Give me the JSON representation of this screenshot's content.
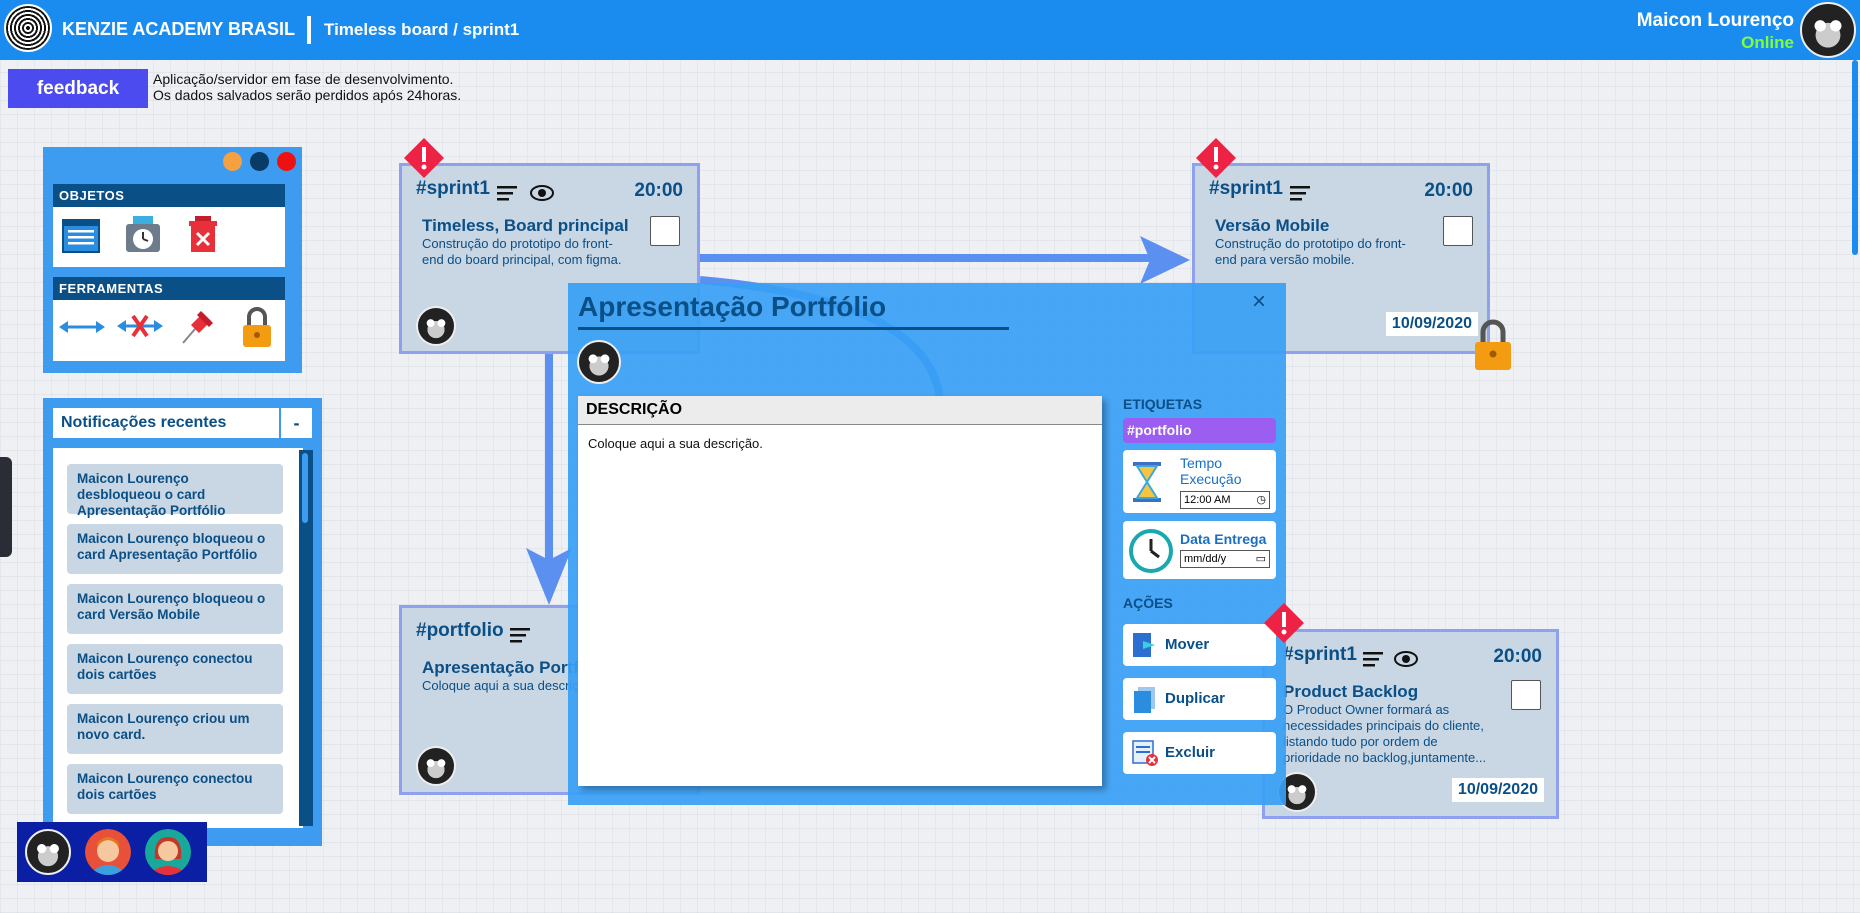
{
  "header": {
    "brand": "KENZIE ACADEMY BRASIL",
    "breadcrumb": "Timeless board / sprint1",
    "user_name": "Maicon Lourenço",
    "user_status": "Online",
    "bg_color": "#1a8cf0"
  },
  "notice": {
    "feedback_label": "feedback",
    "line1": "Aplicação/servidor em fase de desenvolvimento.",
    "line2": "Os dados salvados serão perdidos após 24horas."
  },
  "toolpanel": {
    "objects_title": "OBJETOS",
    "objects": [
      "window-icon",
      "clock-box-icon",
      "trash-icon"
    ],
    "tools_title": "FERRAMENTAS",
    "tools": [
      "connect-arrow-icon",
      "disconnect-arrow-icon",
      "pin-icon",
      "lock-icon"
    ]
  },
  "notifications": {
    "title": "Notificações recentes",
    "minimize_label": "-",
    "items": [
      "Maicon Lourenço desbloqueou o card Apresentação Portfólio",
      "Maicon Lourenço bloqueou o card Apresentação Portfólio",
      "Maicon Lourenço bloqueou o card Versão Mobile",
      "Maicon Lourenço conectou dois cartões",
      "Maicon Lourenço criou um novo card.",
      "Maicon Lourenço conectou dois cartões"
    ]
  },
  "cards": {
    "board": {
      "tag": "#sprint1",
      "time": "20:00",
      "title": "Timeless, Board principal",
      "desc1": "Construção do prototipo do front-",
      "desc2": "end do board principal, com figma."
    },
    "mobile": {
      "tag": "#sprint1",
      "time": "20:00",
      "title": "Versão Mobile",
      "desc1": "Construção do prototipo do front-",
      "desc2": "end para versão mobile.",
      "date": "10/09/2020"
    },
    "portfolio": {
      "tag": "#portfolio",
      "title": "Apresentação Portfólio",
      "desc": "Coloque aqui a sua descrição."
    },
    "backlog": {
      "tag": "#sprint1",
      "time": "20:00",
      "title": "Product Backlog",
      "desc1": "O Product Owner formará as",
      "desc2": "necessidades principais do cliente,",
      "desc3": "listando tudo por ordem de",
      "desc4": "prioridade no backlog,juntamente...",
      "date": "10/09/2020"
    }
  },
  "modal": {
    "title": "Apresentação Portfólio",
    "close_label": "×",
    "description_header": "DESCRIÇÃO",
    "description_text": "Coloque aqui a sua descrição.",
    "labels_title": "ETIQUETAS",
    "tag": "#portfolio",
    "exec_time_label1": "Tempo",
    "exec_time_label2": "Execução",
    "exec_time_value": "12:00 AM",
    "delivery_label": "Data Entrega",
    "delivery_value": "mm/dd/y",
    "actions_title": "AÇÕES",
    "move_label": "Mover",
    "duplicate_label": "Duplicar",
    "delete_label": "Excluir"
  },
  "colors": {
    "accent": "#1a8cf0",
    "navy": "#0a4f86",
    "card_bg": "#c9d6e3",
    "tag_purple": "#9b5ef0",
    "online_green": "#7dff3a",
    "warning_red": "#ee2244"
  }
}
